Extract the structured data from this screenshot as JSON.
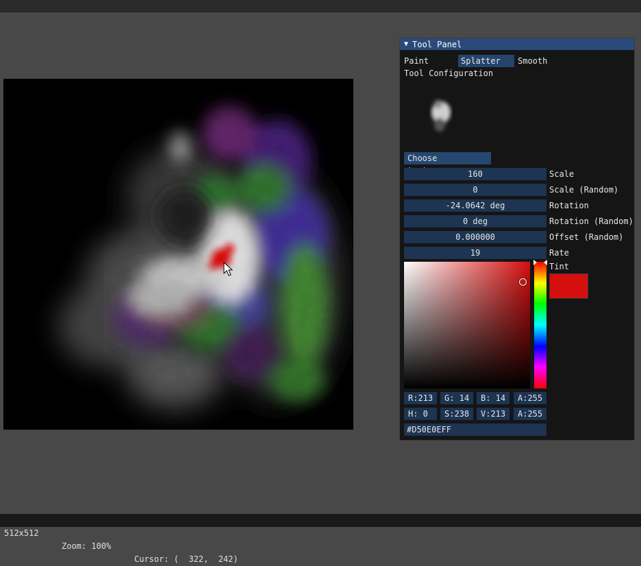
{
  "image": {
    "width": 512,
    "height": 512
  },
  "panel": {
    "title": "Tool Panel",
    "tabs": [
      "Paint",
      "Splatter",
      "Smooth"
    ],
    "selected_tab": "Splatter",
    "section_title": "Tool Configuration",
    "choose_texture_label": "Choose texture...",
    "params": [
      {
        "value": "160",
        "label": "Scale"
      },
      {
        "value": "0",
        "label": "Scale (Random)"
      },
      {
        "value": "-24.0642 deg",
        "label": "Rotation"
      },
      {
        "value": "0 deg",
        "label": "Rotation (Random)"
      },
      {
        "value": "0.000000",
        "label": "Offset (Random)"
      },
      {
        "value": "19",
        "label": "Rate"
      }
    ],
    "tint": {
      "label": "Tint",
      "color": "#d50e0e",
      "rgba": [
        "R:213",
        "G: 14",
        "B: 14",
        "A:255"
      ],
      "hsva": [
        "H:  0",
        "S:238",
        "V:213",
        "A:255"
      ],
      "hex": "#D50E0EFF"
    }
  },
  "status": {
    "size": "512x512",
    "zoom": "Zoom: 100%",
    "cursor": "Cursor: (  322,  242)"
  },
  "icons": {
    "collapse": "triangle-down-icon",
    "pointer": "mouse-pointer-icon"
  }
}
